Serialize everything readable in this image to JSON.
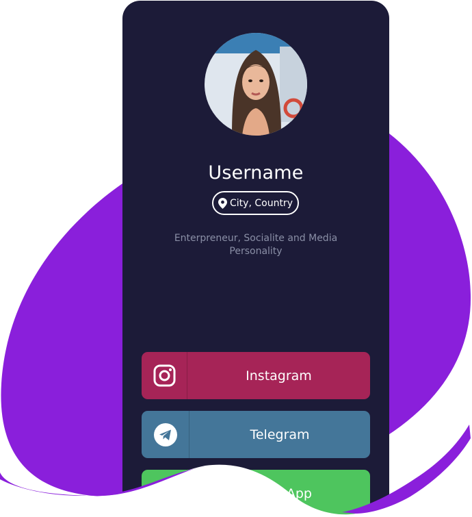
{
  "profile": {
    "username": "Username",
    "location": "City, Country",
    "bio": "Enterpreneur, Socialite and Media Personality"
  },
  "links": [
    {
      "label": "Instagram",
      "icon": "instagram-icon",
      "color": "#a62457"
    },
    {
      "label": "Telegram",
      "icon": "telegram-icon",
      "color": "#447699"
    },
    {
      "label": "WhatsApp",
      "icon": "whatsapp-icon",
      "color": "#4ec55e"
    }
  ],
  "colors": {
    "background_blob": "#8a1fdb",
    "card": "#1c1b38",
    "text": "#ffffff",
    "muted": "#8a8fa6"
  }
}
